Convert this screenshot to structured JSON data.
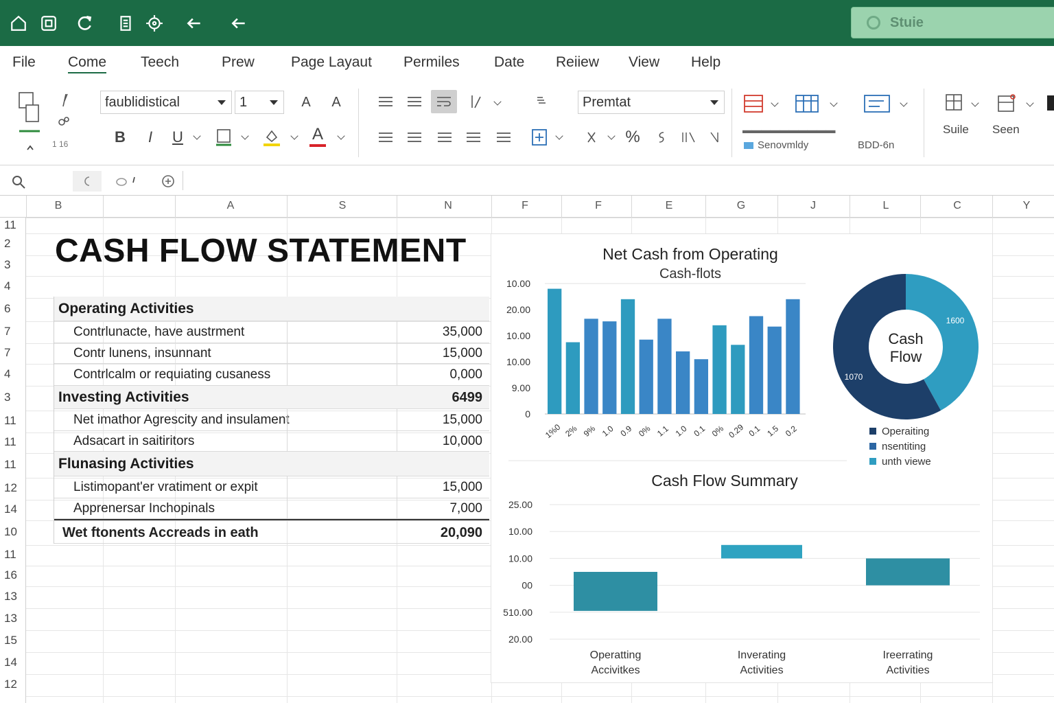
{
  "app": {
    "search_label": "Stuie",
    "colors": {
      "titlebar": "#1b6b45",
      "accent": "#1b6b45"
    }
  },
  "quick_access": [
    "home-icon",
    "save-icon",
    "refresh-icon",
    "document-icon",
    "settings-icon",
    "undo-icon",
    "redo-icon"
  ],
  "menu": {
    "tabs": [
      "File",
      "Come",
      "Teech",
      "Prew",
      "Page Layaut",
      "Permiles",
      "Date",
      "Reiiew",
      "View",
      "Help"
    ],
    "active": "Come"
  },
  "ribbon": {
    "font_name": "faublidistical",
    "font_size": "1",
    "bold": "B",
    "italic": "I",
    "underline": "U",
    "grow_font": "A",
    "shrink_font": "A",
    "font_color": "A",
    "number_format": "Premtat",
    "percent": "%",
    "styles_label_1": "Senovmldy",
    "styles_label_2": "BDD-6n",
    "suite_label": "Suile",
    "seen_label": "Seen",
    "clip_label": "1 16"
  },
  "columns": [
    "B",
    "A",
    "S",
    "N",
    "F",
    "F",
    "E",
    "G",
    "J",
    "L",
    "C",
    "Y"
  ],
  "rows": [
    "11",
    "2",
    "3",
    "4",
    "6",
    "7",
    "7",
    "4",
    "3",
    "11",
    "11",
    "11",
    "12",
    "14",
    "10",
    "11",
    "16",
    "13",
    "13",
    "15",
    "14",
    "12"
  ],
  "statement": {
    "title": "CASH FLOW STATEMENT",
    "rows": [
      {
        "kind": "section",
        "label": "Operating Activities",
        "value": ""
      },
      {
        "kind": "item",
        "label": "Contrlunacte, have austrment",
        "value": "35,000"
      },
      {
        "kind": "item",
        "label": "Contr lunens, insunnant",
        "value": "15,000"
      },
      {
        "kind": "item",
        "label": "Contrlcalm or requiating cusaness",
        "value": "0,000"
      },
      {
        "kind": "section",
        "label": "Investing Activities",
        "value": "6499"
      },
      {
        "kind": "item",
        "label": "Net imathor Agrescity and insulament",
        "value": "15,000"
      },
      {
        "kind": "item",
        "label": "Adsacart in saitiritors",
        "value": "10,000"
      },
      {
        "kind": "section",
        "label": "Flunasing Activities",
        "value": ""
      },
      {
        "kind": "item",
        "label": "Listimopant'er vratiment or expit",
        "value": "15,000"
      },
      {
        "kind": "item",
        "label": "Apprenersar Inchopinals",
        "value": "7,000"
      },
      {
        "kind": "total",
        "label": "Wet ftonents Accreads in eath",
        "value": "20,090"
      }
    ]
  },
  "chart_data": [
    {
      "type": "bar",
      "title": "Net Cash from Operating",
      "subtitle": "Cash-flots",
      "y_tick_labels": [
        "10.00",
        "20.00",
        "10.00",
        "10.00",
        "9.00",
        "0"
      ],
      "x_tick_labels": [
        "1%0",
        "2%",
        "9%",
        "1.0",
        "0.9",
        "0%",
        "1.1",
        "1.0",
        "0.1",
        "0%",
        "0.29",
        "0.1",
        "1.5",
        "0.2"
      ],
      "values": [
        0.96,
        0.55,
        0.73,
        0.71,
        0.88,
        0.57,
        0.73,
        0.48,
        0.42,
        0.68,
        0.53,
        0.75,
        0.67,
        0.88
      ],
      "colors": [
        "#2e9bbf",
        "#2e9bbf",
        "#3a86c6",
        "#3a86c6",
        "#2e9bbf",
        "#3a86c6",
        "#3a86c6",
        "#3a86c6",
        "#3a86c6",
        "#2e9bbf",
        "#2e9bbf",
        "#3a86c6",
        "#3a86c6",
        "#3a86c6"
      ]
    },
    {
      "type": "pie",
      "center_label_1": "Cash",
      "center_label_2": "Flow",
      "slices": [
        {
          "name": "Operaiting",
          "value": 58,
          "label": "1070",
          "color": "#1d3f69"
        },
        {
          "name": "nsentiting",
          "value": 42,
          "label": "1600",
          "color": "#2f9dc1"
        }
      ],
      "legend": [
        "Operaiting",
        "nsentiting",
        "unth viewe"
      ],
      "legend_colors": [
        "#1d3f69",
        "#2c66a3",
        "#2f9dc1"
      ]
    },
    {
      "type": "bar",
      "title": "Cash Flow Summary",
      "y_tick_labels": [
        "25.00",
        "10.00",
        "10.00",
        "00",
        "510.00",
        "20.00"
      ],
      "categories": [
        "Operatting Accivitkes",
        "Inverating Activities",
        "Ireerrating Activities"
      ],
      "values": [
        -1.45,
        0.5,
        0.0
      ],
      "bases": [
        0.5,
        1.0,
        1.0
      ],
      "colors": [
        "#2e8fa3",
        "#2fa3c1",
        "#2e8fa3"
      ]
    }
  ]
}
